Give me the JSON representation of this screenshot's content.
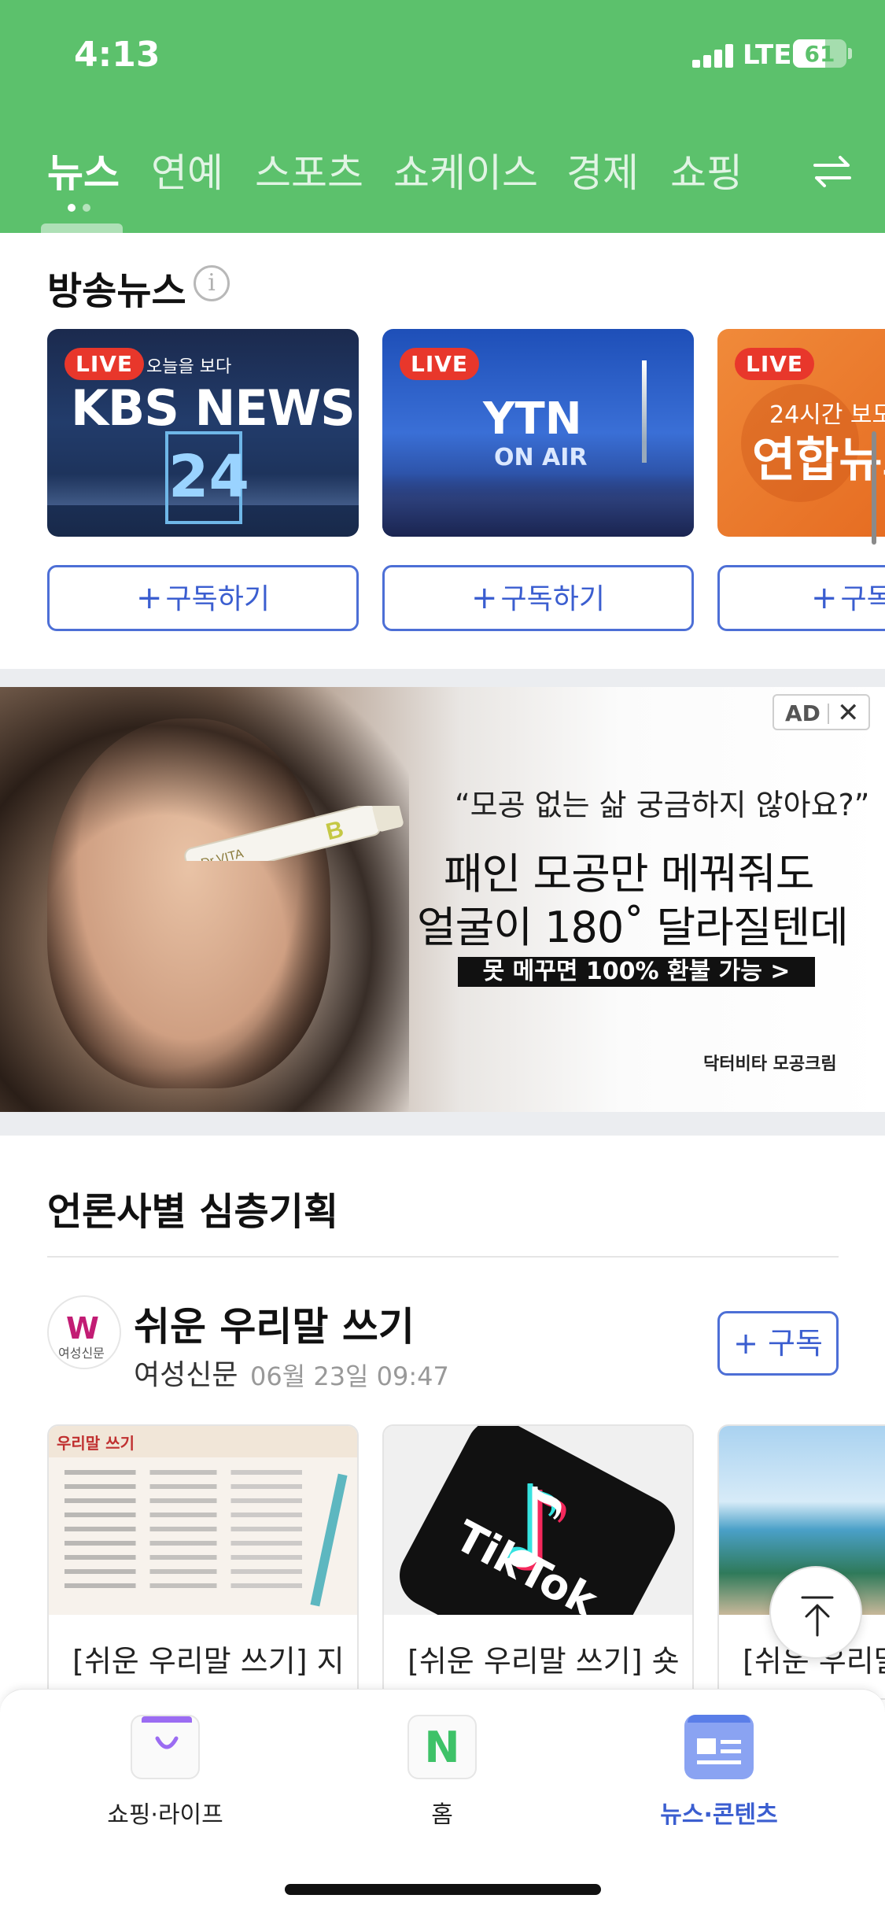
{
  "status_bar": {
    "time": "4:13",
    "network": "LTE",
    "battery": "61"
  },
  "tabs": [
    {
      "label": "뉴스",
      "active": true
    },
    {
      "label": "연예",
      "active": false
    },
    {
      "label": "스포츠",
      "active": false
    },
    {
      "label": "쇼케이스",
      "active": false
    },
    {
      "label": "경제",
      "active": false
    },
    {
      "label": "쇼핑",
      "active": false
    }
  ],
  "broadcast": {
    "title": "방송뉴스",
    "info_icon": "i",
    "channels": [
      {
        "live": "LIVE",
        "sub": "오늘을 보다",
        "logo": "KBS NEWS",
        "num": "24"
      },
      {
        "live": "LIVE",
        "logo": "YTN",
        "sub": "ON AIR"
      },
      {
        "live": "LIVE",
        "sub": "24시간 보도",
        "logo": "연합뉴스"
      }
    ],
    "subscribe_label": "구독하기",
    "subscribe_plus": "+"
  },
  "ad": {
    "badge": "AD",
    "close": "✕",
    "quote": "“모공 없는 삶 궁금하지 않아요?”",
    "line1": "패인 모공만 메꿔줘도",
    "line2": "얼굴이 180˚ 달라질텐데",
    "cta": "못 메꾸면 100% 환불 가능 >",
    "brand": "닥터비타 모공크림",
    "product": "Dr.VITA"
  },
  "press": {
    "section_title": "언론사별 심층기획",
    "series_title": "쉬운 우리말 쓰기",
    "press_name": "여성신문",
    "logo_name": "여성신문",
    "date": "06월 23일 09:47",
    "subscribe": "+ 구독",
    "articles": [
      {
        "text": "[쉬운 우리말 쓰기] 지",
        "thumb_label": "우리말 쓰기"
      },
      {
        "text": "[쉬운 우리말 쓰기] 숏",
        "thumb_label": "TikTok"
      },
      {
        "text": "[쉬운 우리말"
      }
    ]
  },
  "bottom_nav": [
    {
      "label": "쇼핑·라이프",
      "icon": "shopping-bag-icon",
      "active": false
    },
    {
      "label": "홈",
      "icon": "naver-n-icon",
      "glyph": "N",
      "active": false
    },
    {
      "label": "뉴스·콘텐츠",
      "icon": "news-card-icon",
      "active": true
    }
  ],
  "colors": {
    "header_green": "#5cc16c",
    "accent_blue": "#3b5ed0",
    "live_red": "#e8372b"
  }
}
